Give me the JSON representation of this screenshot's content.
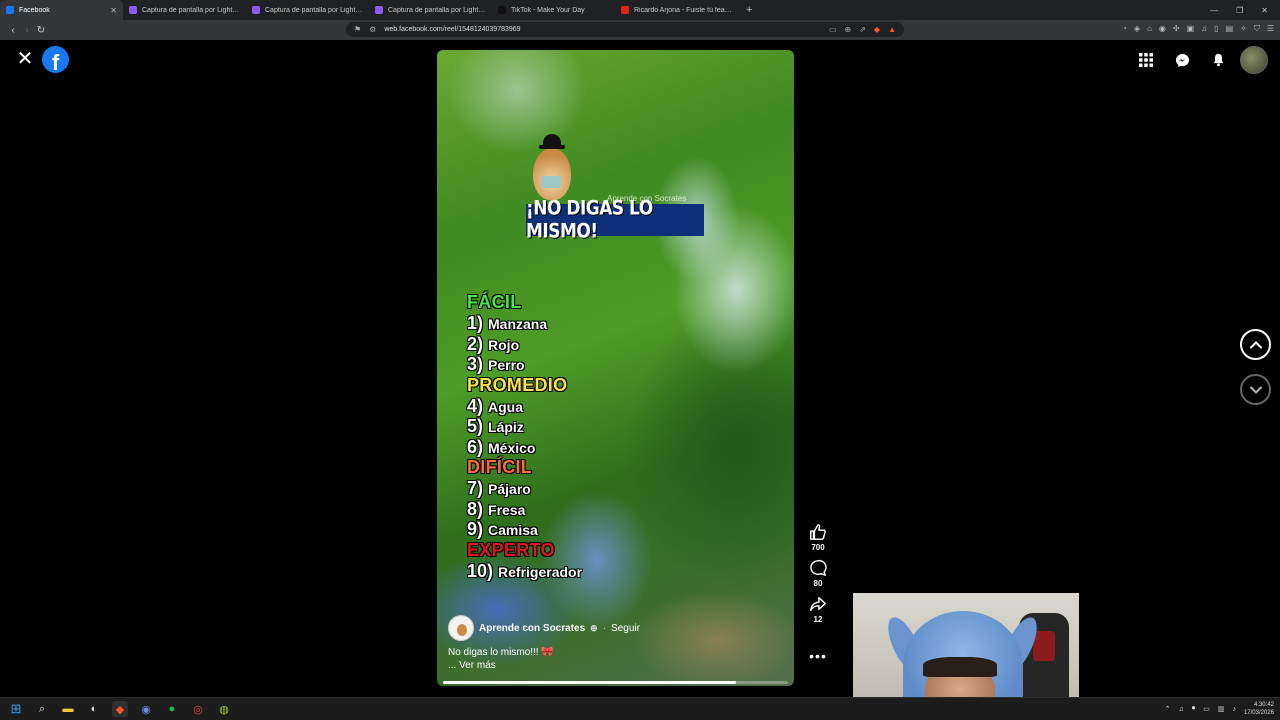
{
  "browser": {
    "tabs": [
      {
        "title": "Facebook",
        "favicon": "facebook-favicon",
        "active": true
      },
      {
        "title": "Captura de pantalla por Lightshot",
        "favicon": "lightshot-favicon",
        "active": false
      },
      {
        "title": "Captura de pantalla por Lightshot",
        "favicon": "lightshot-favicon",
        "active": false
      },
      {
        "title": "Captura de pantalla por Lightshot",
        "favicon": "lightshot-favicon",
        "active": false
      },
      {
        "title": "TikTok - Make Your Day",
        "favicon": "tiktok-favicon",
        "active": false
      },
      {
        "title": "Ricardo Arjona - Fuiste tú feat. Gaby",
        "favicon": "youtube-favicon",
        "active": false
      }
    ],
    "url": "web.facebook.com/reel/1548124039783969"
  },
  "reel": {
    "title": "¡NO DIGAS LO MISMO!",
    "watermark": "Aprende con Socrates",
    "levels": [
      {
        "label": "FÁCIL",
        "tone": "easy",
        "items": [
          {
            "num": "1)",
            "word": "Manzana"
          },
          {
            "num": "2)",
            "word": "Rojo"
          },
          {
            "num": "3)",
            "word": "Perro"
          }
        ]
      },
      {
        "label": "PROMEDIO",
        "tone": "mid",
        "items": [
          {
            "num": "4)",
            "word": "Agua"
          },
          {
            "num": "5)",
            "word": "Lápiz"
          },
          {
            "num": "6)",
            "word": "México"
          }
        ]
      },
      {
        "label": "DIFÍCIL",
        "tone": "hard",
        "items": [
          {
            "num": "7)",
            "word": "Pájaro"
          },
          {
            "num": "8)",
            "word": "Fresa"
          },
          {
            "num": "9)",
            "word": "Camisa"
          }
        ]
      },
      {
        "label": "EXPERTO",
        "tone": "exp",
        "items": [
          {
            "num": "10)",
            "word": "Refrigerador"
          }
        ]
      }
    ],
    "author": "Aprende con Socrates",
    "follow_label": "Seguir",
    "caption": "No digas lo mismo!!!",
    "see_more": "... Ver más",
    "progress": 0.85,
    "likes": "700",
    "comments": "80",
    "shares": "12"
  },
  "taskbar": {
    "time": "4:30:42",
    "date": "17/03/2026"
  },
  "colors": {
    "facebook_blue": "#1877f2",
    "title_box": "#0f2f78",
    "easy": "#4de54d",
    "mid": "#ffe24a",
    "hard": "#ff6a3a",
    "expert": "#e0161a"
  }
}
